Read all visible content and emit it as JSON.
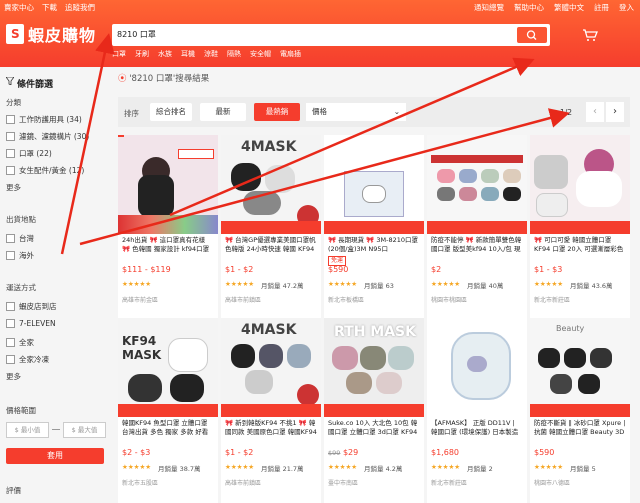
{
  "topbar": {
    "left_links": [
      "賣家中心",
      "下載",
      "追蹤我們"
    ],
    "right_links": [
      "通知總覽",
      "幫助中心",
      "繁體中文",
      "註冊",
      "登入"
    ]
  },
  "logo": {
    "text": "蝦皮購物"
  },
  "search": {
    "value": "8210 口罩",
    "hints": [
      "口罩",
      "牙刷",
      "水族",
      "耳機",
      "涼鞋",
      "隔熱",
      "安全帽",
      "電扇插"
    ]
  },
  "sidebar": {
    "title": "條件篩選",
    "category_heading": "分類",
    "categories": [
      "工作防護用具 (34)",
      "濾鏡、濾鏡構片 (30)",
      "口罩 (22)",
      "女生配件/黃金 (12)"
    ],
    "category_more": "更多",
    "location_heading": "出貨地點",
    "locations": [
      "台灣",
      "海外"
    ],
    "shipping_heading": "運送方式",
    "shipping": [
      "蝦皮店到店",
      "7-ELEVEN",
      "全家",
      "全家冷凍"
    ],
    "shipping_more": "更多",
    "price_heading": "價格範圍",
    "price_min_placeholder": "$ 最小值",
    "price_max_placeholder": "$ 最大值",
    "apply_label": "套用",
    "rating_heading": "評價"
  },
  "results": {
    "title": "'8210 口罩'搜尋結果"
  },
  "sortbar": {
    "label": "排序",
    "options": [
      "綜合排名",
      "最新",
      "最熱銷"
    ],
    "price_select": "價格",
    "page_indicator": "1/2"
  },
  "products": [
    {
      "name": "24h出貨 🎀 這口罩真有花樣 🎀 色韓國 獨家設計 kf94口罩 一..",
      "price": "$111 - $119",
      "stars": "★★★★★",
      "sold": "",
      "loc": "高雄市前金區"
    },
    {
      "name": "🎀 台灣GP優選專業美國口罩帆 色韓版 24小時快速 韓國 KF94",
      "price": "$1 - $2",
      "stars": "★★★★★",
      "sold": "月銷量 47.2萬",
      "loc": "高雄市前鎮區"
    },
    {
      "name": "🎀 長期現貨 🎀 3M-8210口罩 (20個/盒)3M N95口",
      "price": "$590",
      "stars": "★★★★★",
      "sold": "月銷量 63",
      "loc": "新北市板橋區"
    },
    {
      "name": "防疫不能停 🎀 新款簡單雙色韓國口罩 版型美kf94 10入/包 現貨",
      "price": "$2",
      "stars": "★★★★★",
      "sold": "月銷量 40萬",
      "loc": "桃園市桃園區"
    },
    {
      "name": "🎀 可口可愛 韓國立體口罩KF94 口罩 20入 可選漸層彩色韓國人氣口罩",
      "price": "$1 - $3",
      "stars": "★★★★★",
      "sold": "月銷量 43.6萬",
      "loc": "新北市新莊區"
    },
    {
      "name": "韓國KF94 魚型口罩 立體口罩 台灣出貨 多色 獨家 多款 好看韓國",
      "price": "$2 - $3",
      "stars": "★★★★★",
      "sold": "月銷量 38.7萬",
      "loc": "新北市五股區"
    },
    {
      "name": "🎀 新到韓版KF94 不挑1 🎀 韓國同款 美國原色口罩 韓國KF94 9D",
      "price": "$1 - $2",
      "stars": "★★★★★",
      "sold": "月銷量 21.7萬",
      "loc": "高雄市前鎮區"
    },
    {
      "name": "Suke.co 10入 大北色 10包 韓國口罩 立體口罩 3d口罩 KF94 韓版",
      "price": "$29",
      "stars": "★★★★★",
      "sold": "月銷量 4.2萬",
      "loc": "臺中市南區"
    },
    {
      "name": "【AFMASK】 正版 DD11V | 韓國口罩 (環境保護) 日本製造",
      "price": "$1,680",
      "stars": "★★★★★",
      "sold": "月銷量 2",
      "loc": "新北市新莊區"
    },
    {
      "name": "防疫不斷貨 ‖ 冰砂口罩 Xpure | 抗菌 韓國立體口罩 Beauty 3D",
      "price": "$590",
      "stars": "★★★★★",
      "sold": "月銷量 5",
      "loc": "桃園市八德區"
    }
  ]
}
